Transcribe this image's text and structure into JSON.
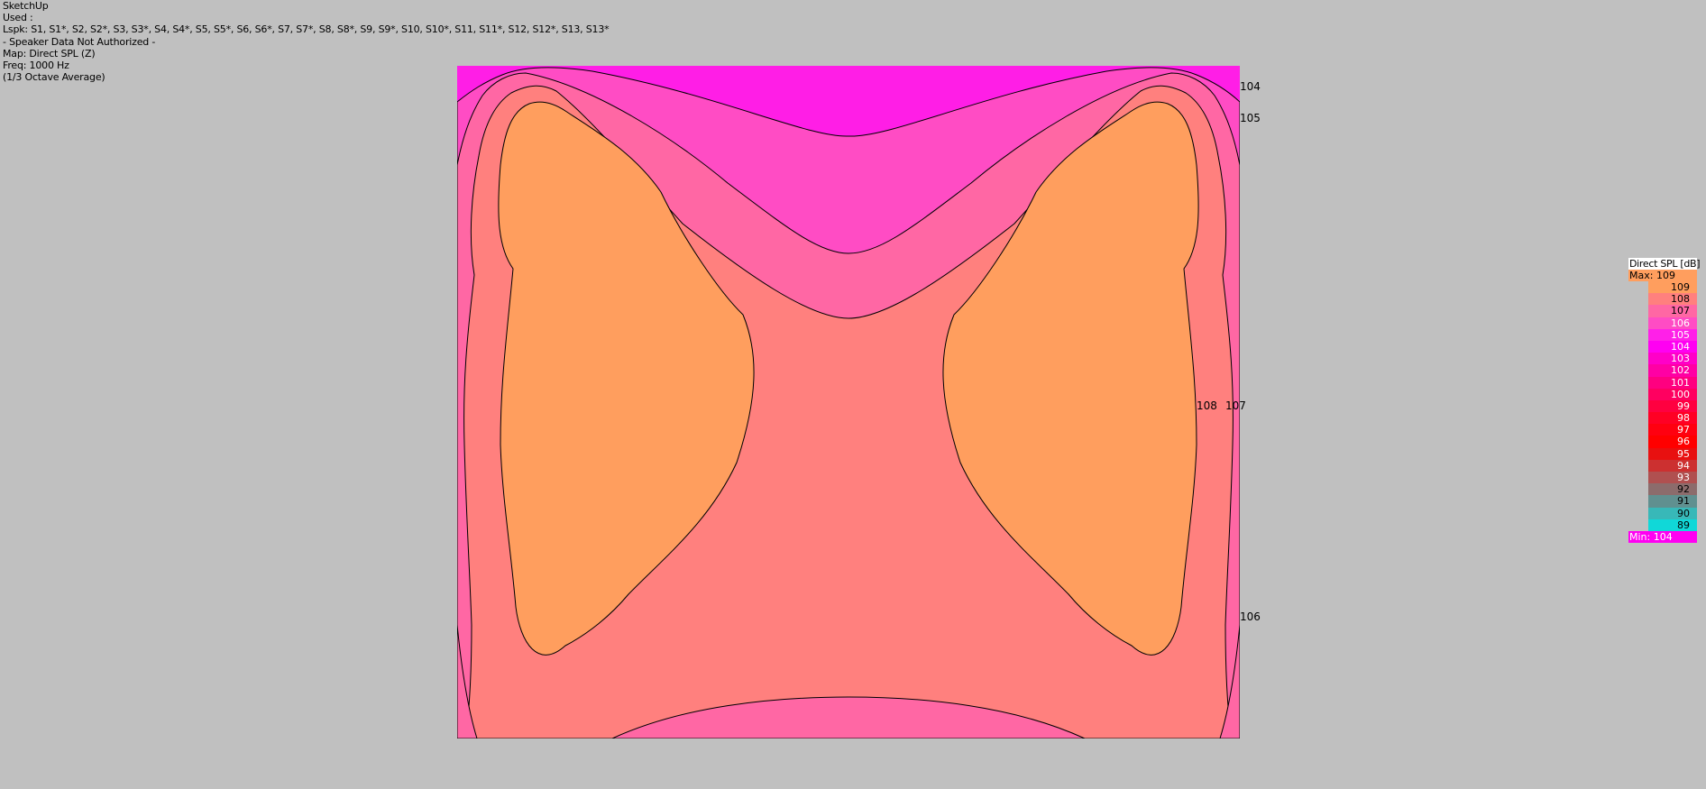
{
  "header": {
    "app": "SketchUp",
    "used": "Used :",
    "lspk": "Lspk: S1, S1*, S2, S2*, S3, S3*, S4, S4*, S5, S5*, S6, S6*, S7, S7*, S8, S8*, S9, S9*, S10, S10*, S11, S11*, S12, S12*, S13, S13*",
    "auth": "- Speaker Data Not Authorized -",
    "map": "Map: Direct SPL (Z)",
    "freq": "Freq: 1000 Hz",
    "avg": "(1/3 Octave Average)"
  },
  "contour_labels": {
    "l104": "104",
    "l105": "105",
    "l108": "108",
    "l107": "107",
    "l106": "106"
  },
  "legend": {
    "title": "Direct SPL [dB]",
    "max_label": "Max:",
    "max_value": "109",
    "min_label": "Min:",
    "min_value": "104",
    "levels": [
      {
        "value": "109",
        "color": "#ff9e5e"
      },
      {
        "value": "108",
        "color": "#ff807e"
      },
      {
        "value": "107",
        "color": "#ff67a4"
      },
      {
        "value": "106",
        "color": "#ff4cc4"
      },
      {
        "value": "105",
        "color": "#ff20e8"
      },
      {
        "value": "104",
        "color": "#ff00f2"
      },
      {
        "value": "103",
        "color": "#ff00c8"
      },
      {
        "value": "102",
        "color": "#ff00a4"
      },
      {
        "value": "101",
        "color": "#ff0080"
      },
      {
        "value": "100",
        "color": "#ff0060"
      },
      {
        "value": "99",
        "color": "#ff0040"
      },
      {
        "value": "98",
        "color": "#ff0024"
      },
      {
        "value": "97",
        "color": "#ff0010"
      },
      {
        "value": "96",
        "color": "#ff0000"
      },
      {
        "value": "95",
        "color": "#e81010"
      },
      {
        "value": "94",
        "color": "#cc3030"
      },
      {
        "value": "93",
        "color": "#b05050"
      },
      {
        "value": "92",
        "color": "#8c6c6c"
      },
      {
        "value": "91",
        "color": "#609090"
      },
      {
        "value": "90",
        "color": "#38b8b8"
      },
      {
        "value": "89",
        "color": "#10d8d8"
      }
    ],
    "colors": {
      "max_bg": "#ff9e5e",
      "min_bg": "#ff00f2"
    }
  }
}
